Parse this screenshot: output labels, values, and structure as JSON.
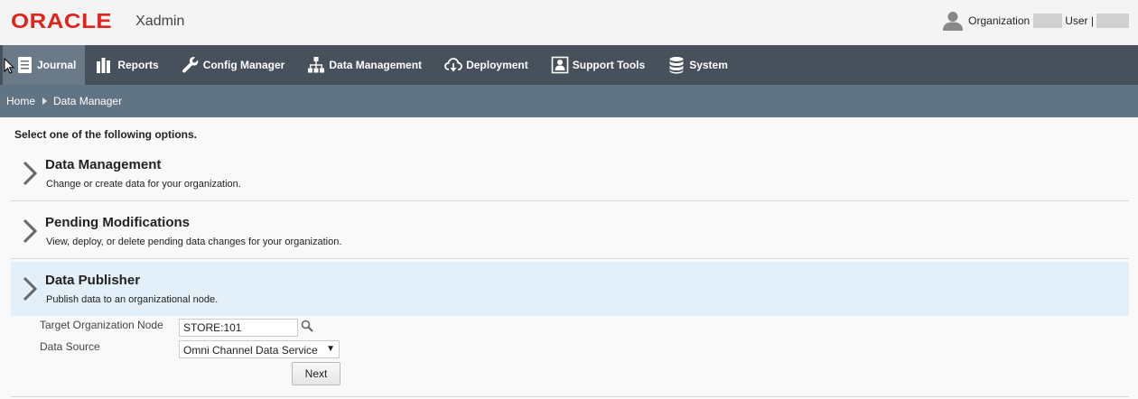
{
  "header": {
    "logo": "ORACLE",
    "product": "Xadmin",
    "organization_label": "Organization",
    "user_label": "User |"
  },
  "nav": {
    "items": [
      {
        "label": "Journal",
        "icon": "journal-icon",
        "active": true
      },
      {
        "label": "Reports",
        "icon": "bar-chart-icon"
      },
      {
        "label": "Config Manager",
        "icon": "wrench-icon"
      },
      {
        "label": "Data Management",
        "icon": "hierarchy-icon"
      },
      {
        "label": "Deployment",
        "icon": "cloud-download-icon"
      },
      {
        "label": "Support Tools",
        "icon": "support-icon"
      },
      {
        "label": "System",
        "icon": "database-icon"
      }
    ]
  },
  "breadcrumb": {
    "home": "Home",
    "current": "Data Manager"
  },
  "main": {
    "instruction": "Select one of the following options.",
    "options": [
      {
        "title": "Data Management",
        "description": "Change or create data for your organization."
      },
      {
        "title": "Pending Modifications",
        "description": "View, deploy, or delete pending data changes for your organization."
      },
      {
        "title": "Data Publisher",
        "description": "Publish data to an organizational node.",
        "selected": true
      }
    ],
    "form": {
      "target_node_label": "Target Organization Node",
      "target_node_value": "STORE:101",
      "data_source_label": "Data Source",
      "data_source_value": "Omni Channel Data Service",
      "next_label": "Next"
    }
  },
  "colors": {
    "brand": "#e2231a",
    "navbar": "#47515c",
    "nav_active": "#6b7a88",
    "breadcrumb_bar": "#617483",
    "selected_option": "#e3eff9"
  }
}
